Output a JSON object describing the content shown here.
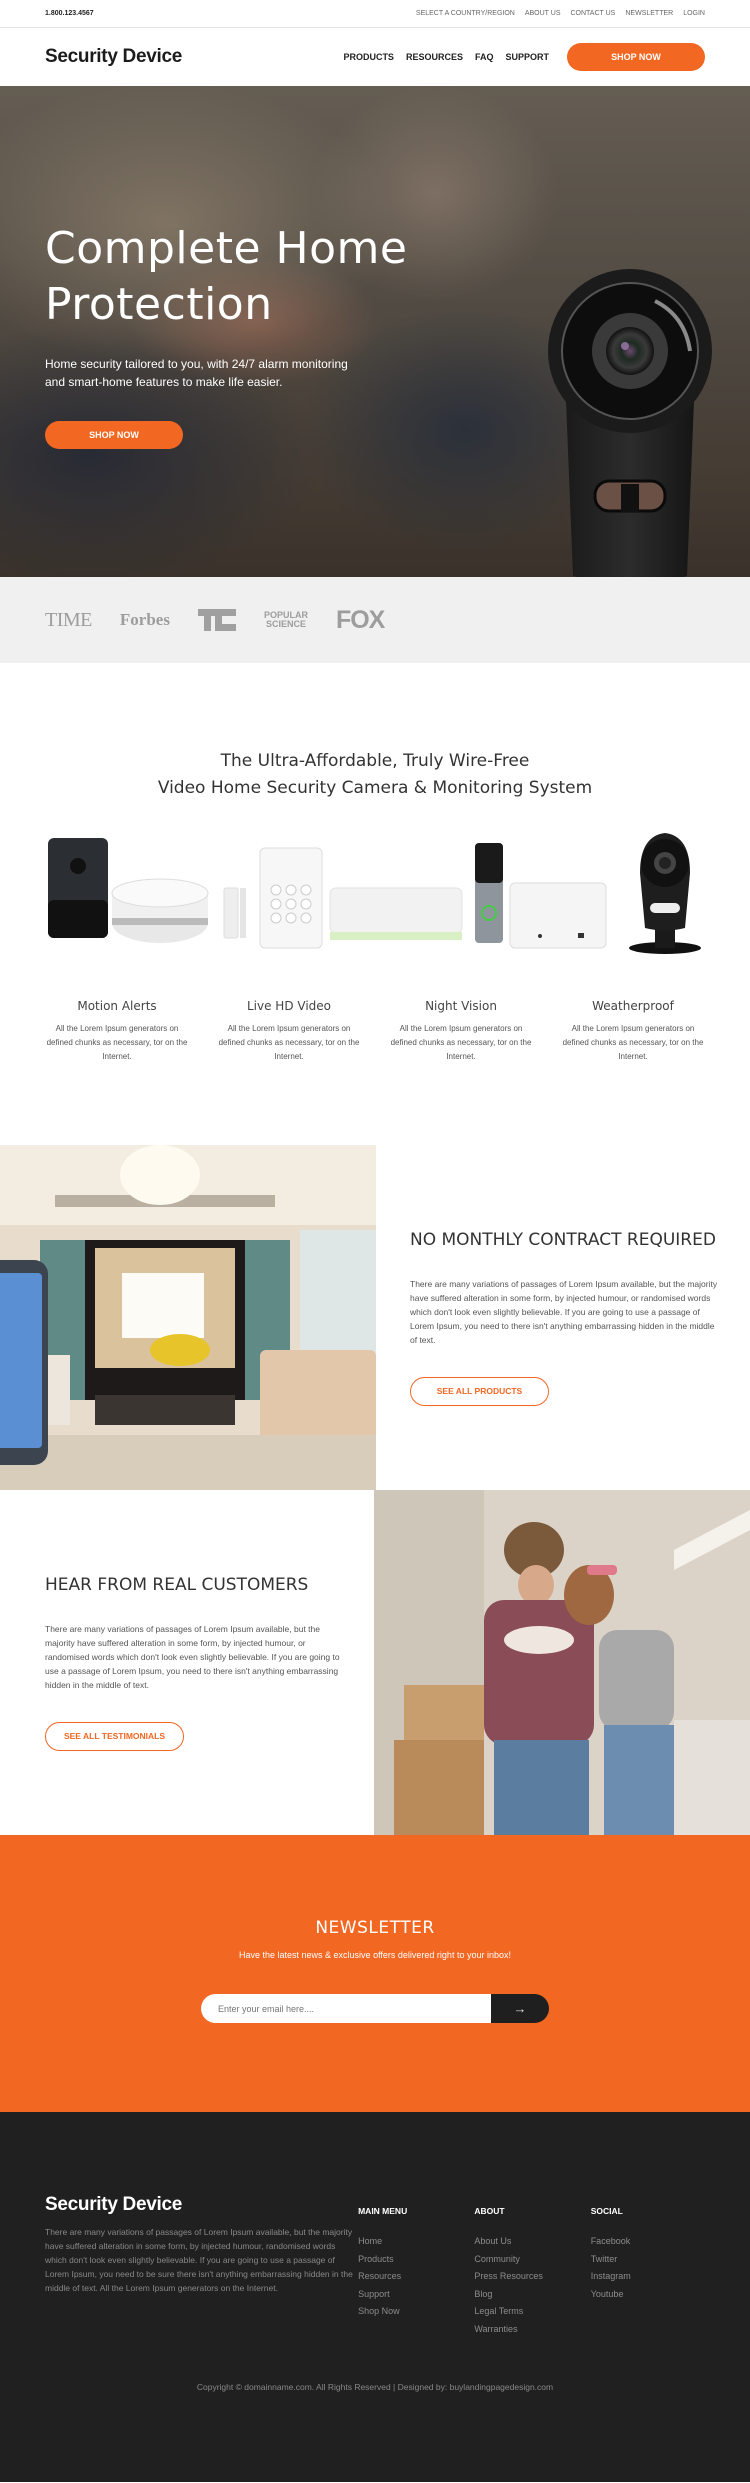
{
  "topbar": {
    "phone": "1.800.123.4567",
    "links": [
      "SELECT A COUNTRY/REGION",
      "ABOUT US",
      "CONTACT US",
      "NEWSLETTER",
      "LOGIN"
    ]
  },
  "nav": {
    "brand": "Security Device",
    "links": [
      "PRODUCTS",
      "RESOURCES",
      "FAQ",
      "SUPPORT"
    ],
    "cta": "SHOP NOW"
  },
  "hero": {
    "title_line1": "Complete Home",
    "title_line2": "Protection",
    "subtitle": "Home security tailored to you, with 24/7 alarm monitoring and smart-home features to make life easier.",
    "cta": "SHOP NOW"
  },
  "press_logos": {
    "time": "TIME",
    "forbes": "Forbes",
    "popular_1": "POPULAR",
    "popular_2": "SCIENCE",
    "fox": "FOX"
  },
  "products": {
    "title_line1": "The Ultra-Affordable, Truly Wire-Free",
    "title_line2": "Video Home Security Camera & Monitoring System",
    "features": [
      {
        "title": "Motion Alerts",
        "text": "All the Lorem Ipsum generators on defined chunks as necessary, tor on the Internet."
      },
      {
        "title": "Live HD Video",
        "text": "All the Lorem Ipsum generators on defined chunks as necessary, tor on the Internet."
      },
      {
        "title": "Night Vision",
        "text": "All the Lorem Ipsum generators on defined chunks as necessary, tor on the Internet."
      },
      {
        "title": "Weatherproof",
        "text": "All the Lorem Ipsum generators on defined chunks as necessary, tor on the Internet."
      }
    ]
  },
  "contract": {
    "title": "NO MONTHLY CONTRACT REQUIRED",
    "text": "There are many variations of passages of Lorem Ipsum available, but the majority have suffered alteration in some form, by injected humour, or randomised words which don't look even slightly believable. If you are going to use a passage of Lorem Ipsum, you need to there isn't anything embarrassing hidden in the middle of text.",
    "cta": "SEE ALL PRODUCTS"
  },
  "customers": {
    "title": "HEAR FROM REAL CUSTOMERS",
    "text": "There are many variations of passages of Lorem Ipsum available, but the majority have suffered alteration in some form, by injected humour, or randomised words which don't look even slightly believable. If you are going to use a passage of Lorem Ipsum, you need to there isn't anything embarrassing hidden in the middle of text.",
    "cta": "SEE ALL TESTIMONIALS"
  },
  "newsletter": {
    "title": "NEWSLETTER",
    "subtitle": "Have the latest news & exclusive offers delivered right to your inbox!",
    "placeholder": "Enter your email here....",
    "submit_icon": "→"
  },
  "footer": {
    "brand": "Security Device",
    "about": "There are many variations of passages of Lorem Ipsum available, but the majority have suffered alteration in some form, by injected humour, randomised words which don't look even slightly believable. If you are going to use a passage of Lorem Ipsum, you need to be sure there isn't anything embarrassing hidden in the middle of text. All the Lorem Ipsum generators on the Internet.",
    "columns": [
      {
        "title": "MAIN MENU",
        "items": [
          "Home",
          "Products",
          "Resources",
          "Support",
          "Shop Now"
        ]
      },
      {
        "title": "ABOUT",
        "items": [
          "About Us",
          "Community",
          "Press Resources",
          "Blog",
          "Legal Terms",
          "Warranties"
        ]
      },
      {
        "title": "SOCIAL",
        "items": [
          "Facebook",
          "Twitter",
          "Instagram",
          "Youtube"
        ]
      }
    ],
    "copyright": "Copyright © domainname.com. All Rights Reserved | Designed by: buylandingpagedesign.com"
  },
  "colors": {
    "accent": "#f26722",
    "dark": "#202020"
  }
}
